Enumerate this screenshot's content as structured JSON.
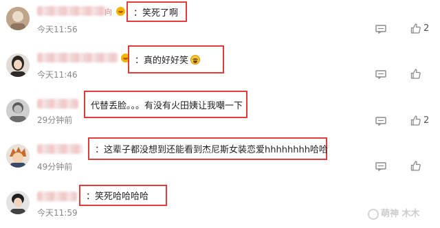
{
  "comments": [
    {
      "name": "向",
      "text": "笑死了啊",
      "time": "今天11:56",
      "likes": "2",
      "emoji": false
    },
    {
      "name": "",
      "text": "真的好好笑",
      "time": "今天11:46",
      "likes": "",
      "emoji": true
    },
    {
      "name": "",
      "text": "代替丢脸。。。有没有火田姨让我嘲一下",
      "time": "29分钟前",
      "likes": "2",
      "emoji": false
    },
    {
      "name": "",
      "text": "这辈子都没想到还能看到杰尼斯女装恋爱hhhhhhhh哈哈",
      "time": "49分钟前",
      "likes": "",
      "emoji": false
    },
    {
      "name": "",
      "text": "笑死哈哈哈哈",
      "time": "今天11:59",
      "likes": "",
      "emoji": false
    }
  ],
  "watermark": "萌神 木木",
  "icons": {
    "reply": "comment-reply-icon",
    "like": "thumbs-up-icon"
  },
  "colors": {
    "highlight_border": "#e23b3b",
    "time_text": "#888888"
  }
}
